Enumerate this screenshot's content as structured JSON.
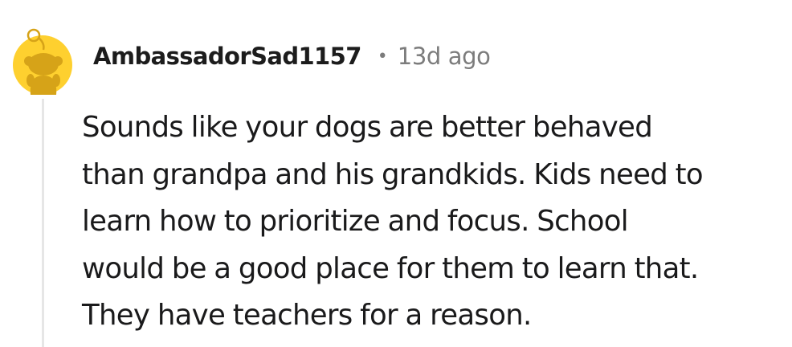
{
  "comment": {
    "author": "AmbassadorSad1157",
    "separator": "•",
    "timestamp": "13d ago",
    "avatar_icon": "snoo-avatar-icon",
    "lines": [
      "Sounds like your dogs are better behaved",
      "than grandpa and his grandkids. Kids need to",
      "learn how to prioritize and focus. School",
      "would be a good place for them to learn that.",
      "They have teachers for a reason."
    ]
  },
  "colors": {
    "avatar_background": "#fed02f",
    "avatar_figure": "#d6a318",
    "thread_line": "#e6e6e6",
    "meta_text": "#7c7c7c",
    "body_text": "#1a1a1b"
  }
}
